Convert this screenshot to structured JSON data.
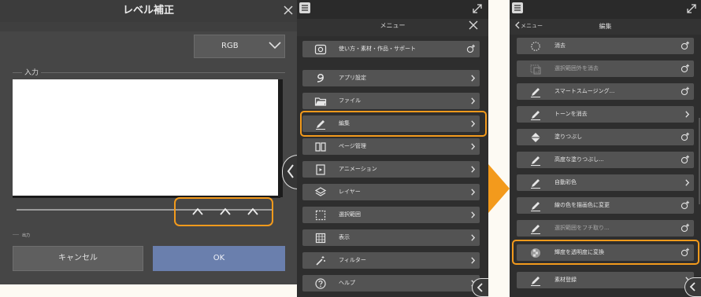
{
  "level_dialog": {
    "title": "レベル補正",
    "channel_select": "RGB",
    "input_label": "入力",
    "output_label": "出力",
    "cancel_label": "キャンセル",
    "ok_label": "OK"
  },
  "menu_panel": {
    "title": "メニュー",
    "items": [
      {
        "label": "使い方・素材・作品・サポート",
        "icon": "help-support-icon",
        "action": "add"
      },
      {
        "label": "アプリ設定",
        "icon": "app-settings-icon",
        "action": "chevron"
      },
      {
        "label": "ファイル",
        "icon": "folder-icon",
        "action": "chevron"
      },
      {
        "label": "編集",
        "icon": "pen-icon",
        "action": "chevron",
        "highlighted": true
      },
      {
        "label": "ページ管理",
        "icon": "book-icon",
        "action": "chevron"
      },
      {
        "label": "アニメーション",
        "icon": "film-icon",
        "action": "chevron"
      },
      {
        "label": "レイヤー",
        "icon": "layers-icon",
        "action": "chevron"
      },
      {
        "label": "選択範囲",
        "icon": "selection-icon",
        "action": "chevron"
      },
      {
        "label": "表示",
        "icon": "grid-icon",
        "action": "chevron"
      },
      {
        "label": "フィルター",
        "icon": "magic-wand-icon",
        "action": "chevron"
      },
      {
        "label": "ヘルプ",
        "icon": "question-icon",
        "action": "chevron"
      }
    ]
  },
  "edit_panel": {
    "back_label": "メニュー",
    "title": "編集",
    "items": [
      {
        "label": "消去",
        "icon": "erase-icon",
        "action": "add"
      },
      {
        "label": "選択範囲外を消去",
        "icon": "erase-outside-icon",
        "action": "add",
        "dim": true
      },
      {
        "label": "スマートスムージング...",
        "icon": "pen-icon",
        "action": "add"
      },
      {
        "label": "トーンを消去",
        "icon": "pen-icon",
        "action": "chevron"
      },
      {
        "label": "塗りつぶし",
        "icon": "fill-bucket-icon",
        "action": "add"
      },
      {
        "label": "高度な塗りつぶし...",
        "icon": "pen-icon",
        "action": "add"
      },
      {
        "label": "自動彩色",
        "icon": "pen-icon",
        "action": "chevron"
      },
      {
        "label": "線の色を描画色に変更",
        "icon": "pen-icon",
        "action": "add"
      },
      {
        "label": "選択範囲をフチ取り...",
        "icon": "pen-icon",
        "action": "add",
        "dim": true
      },
      {
        "label": "輝度を透明度に変換",
        "icon": "checker-icon",
        "action": "add",
        "highlighted": true
      },
      {
        "label": "素材登録",
        "icon": "pen-icon",
        "action": "chevron"
      }
    ]
  },
  "colors": {
    "highlight": "#f39a1c",
    "ok_button": "#6a7fad",
    "menu_item": "#535353",
    "panel_bg": "#2e2e2e"
  }
}
